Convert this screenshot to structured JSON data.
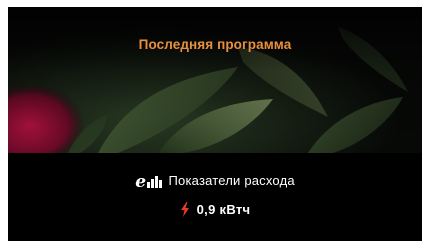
{
  "program": {
    "title": "Последняя программа"
  },
  "consumption": {
    "label": "Показатели расхода",
    "icon": "eco-consumption-icon",
    "energy_value": "0,9 кВтч",
    "energy_icon": "lightning-bolt-icon"
  },
  "colors": {
    "title_accent": "#e9903f",
    "bolt": "#e63a2a",
    "background": "#000000",
    "text": "#ffffff"
  }
}
